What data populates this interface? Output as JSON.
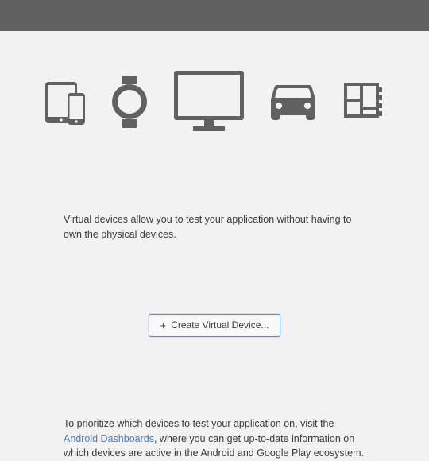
{
  "description": "Virtual devices allow you to test your application without having to own the physical devices.",
  "create_button": {
    "label": "Create Virtual Device..."
  },
  "footer": {
    "prefix": "To prioritize which devices to test your application on, visit the ",
    "link_text": "Android Dashboards",
    "suffix": ", where you can get up-to-date information on which devices are active in the Android and Google Play ecosystem."
  },
  "icons": {
    "phone_tablet": "phone-tablet-icon",
    "watch": "watch-icon",
    "monitor": "monitor-icon",
    "car": "car-icon",
    "things": "things-icon"
  }
}
